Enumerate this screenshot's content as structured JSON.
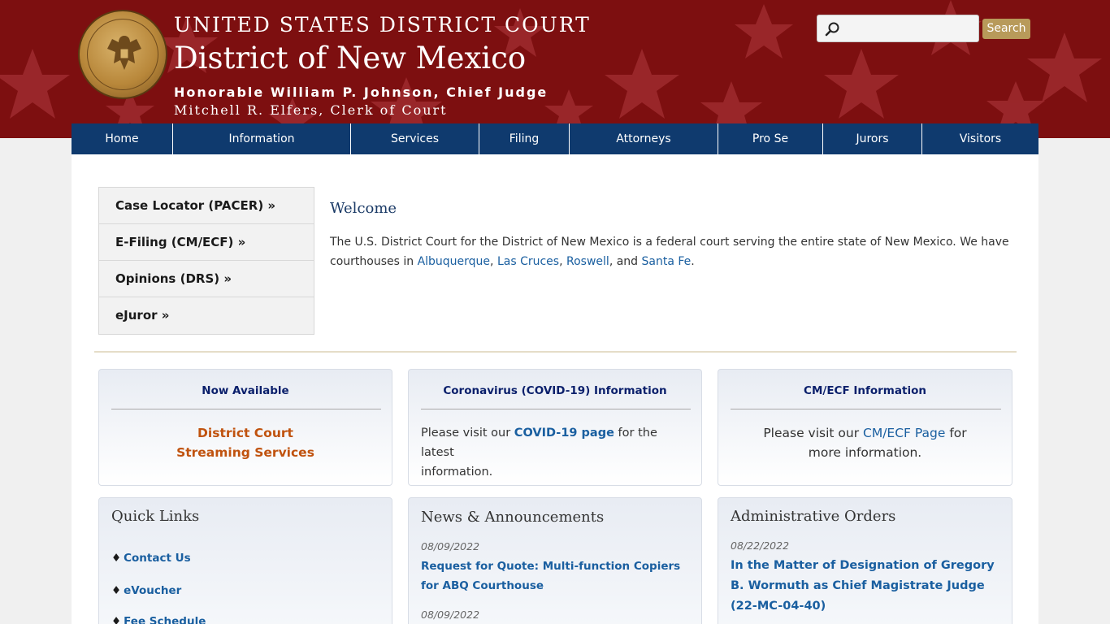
{
  "header": {
    "line1": "UNITED STATES DISTRICT COURT",
    "line2": "District of New Mexico",
    "chief_judge": "Honorable William P. Johnson, Chief Judge",
    "clerk": "Mitchell R. Elfers, Clerk of Court",
    "seal_text_top": "UNITED STATES DISTRICT COURT",
    "seal_text_bottom": "DISTRICT OF NEW MEXICO",
    "search_placeholder": "",
    "search_button": "Search",
    "colors": {
      "banner": "#7d0f10",
      "nav": "#0f3a6e",
      "search_button": "#b89a5a"
    }
  },
  "nav": {
    "items": [
      "Home",
      "Information",
      "Services",
      "Filing",
      "Attorneys",
      "Pro Se",
      "Jurors",
      "Visitors"
    ]
  },
  "sidebar": {
    "items": [
      "Case Locator (PACER) »",
      "E-Filing (CM/ECF) »",
      "Opinions (DRS) »",
      "eJuror »"
    ]
  },
  "welcome": {
    "title": "Welcome",
    "text_before": "The U.S. District Court for the District of New Mexico is a federal court serving the entire state of New Mexico. We have courthouses in ",
    "city1": "Albuquerque",
    "sep1": ", ",
    "city2": "Las Cruces",
    "sep2": ", ",
    "city3": "Roswell",
    "sep3": ", and ",
    "city4": "Santa Fe",
    "end": "."
  },
  "cards": {
    "card1": {
      "title": "Now Available",
      "link_line1": "District Court",
      "link_line2": "Streaming Services"
    },
    "card2": {
      "title": "Coronavirus (COVID-19) Information",
      "text1": "Please visit our ",
      "link": "COVID-19 page",
      "text2": " for the latest",
      "text3": "information."
    },
    "card3": {
      "title": "CM/ECF Information",
      "text1": "Please visit our ",
      "link": "CM/ECF Page",
      "text2": " for",
      "text3": "more information."
    }
  },
  "quick_links": {
    "title": "Quick Links",
    "bullet": "♦",
    "items": [
      "Contact Us",
      "eVoucher",
      "Fee Schedule"
    ]
  },
  "news": {
    "title": "News & Announcements",
    "items": [
      {
        "date": "08/09/2022",
        "title": "Request for Quote: Multi-function Copiers for ABQ Courthouse"
      },
      {
        "date": "08/09/2022",
        "title": ""
      }
    ]
  },
  "admin_orders": {
    "title": "Administrative Orders",
    "items": [
      {
        "date": "08/22/2022",
        "title": "In the Matter of Designation of Gregory B. Wormuth as Chief Magistrate Judge (22-MC-04-40)"
      }
    ]
  }
}
